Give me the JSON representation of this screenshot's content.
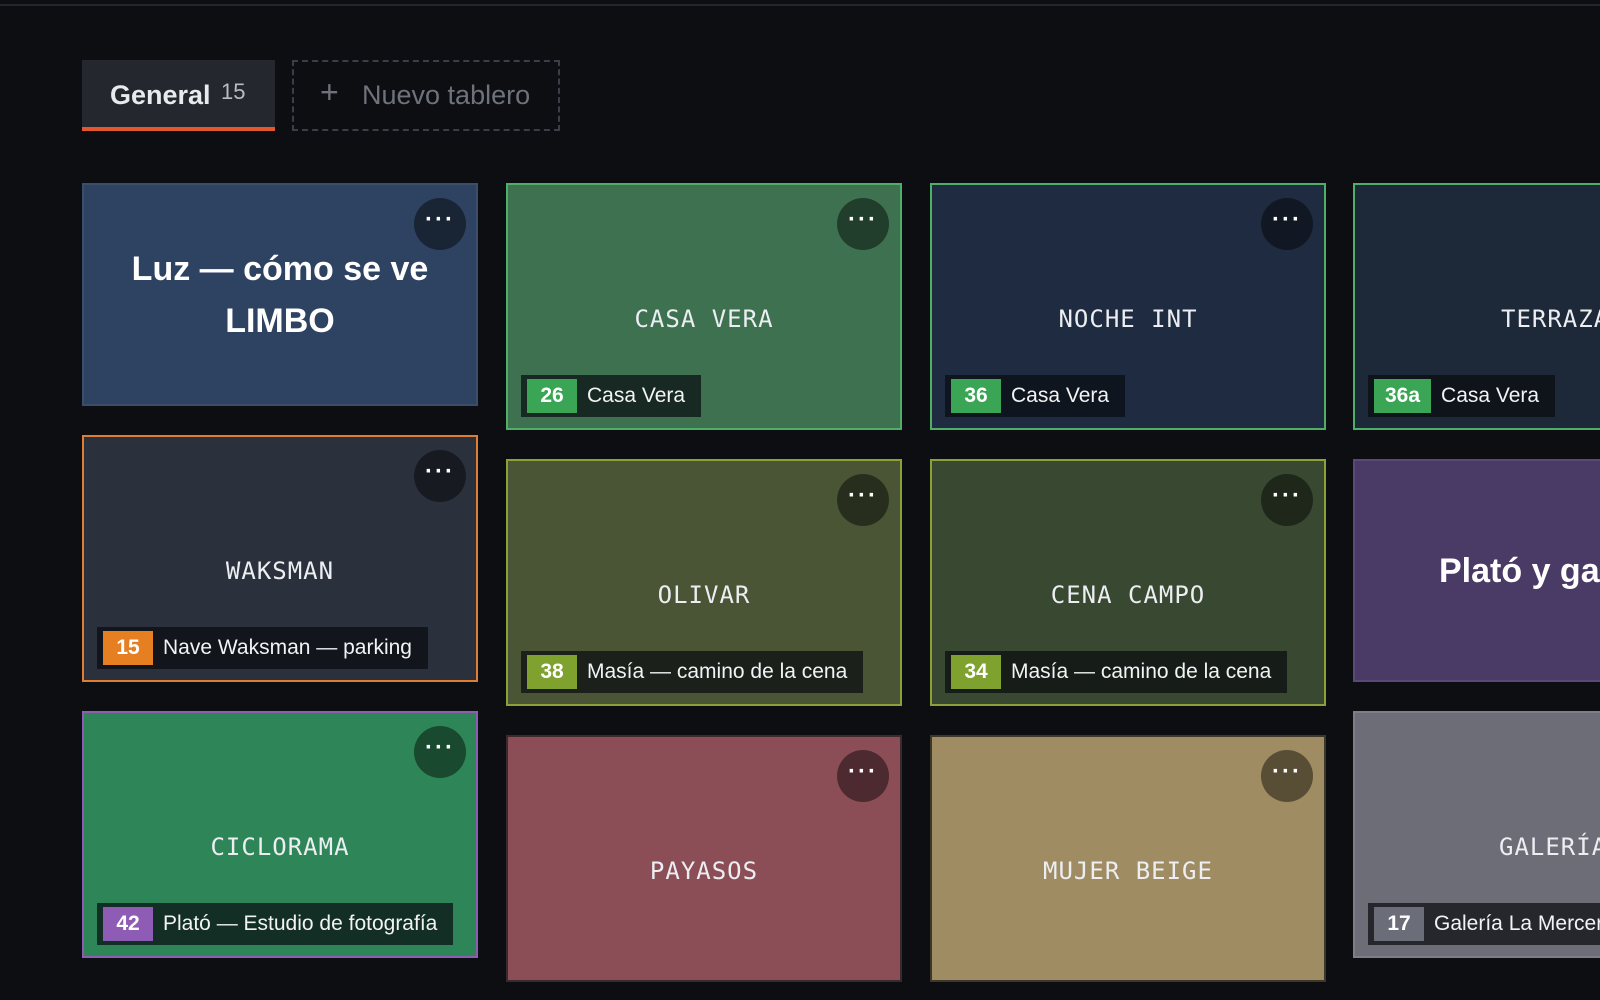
{
  "tabs": {
    "general_label": "General",
    "general_count": "15",
    "new_board_label": "Nuevo tablero"
  },
  "more_glyph": "···",
  "colors": {
    "accent": "#e4572e",
    "green_tag": "#3aa655",
    "olive_tag": "#7fa12e",
    "orange_tag": "#e67e22",
    "purple_tag": "#8e5bb5",
    "gray_tag": "#6b6e78"
  },
  "cards": [
    {
      "title": "Luz — cómo se ve LIMBO",
      "style": "bold"
    },
    {
      "title": "CASA VERA",
      "tag_num": "26",
      "tag_label": "Casa Vera"
    },
    {
      "title": "NOCHE INT",
      "tag_num": "36",
      "tag_label": "Casa Vera"
    },
    {
      "title": "TERRAZA",
      "tag_num": "36a",
      "tag_label": "Casa Vera"
    },
    {
      "title": "WAKSMAN",
      "tag_num": "15",
      "tag_label": "Nave Waksman — parking"
    },
    {
      "title": "OLIVAR",
      "tag_num": "38",
      "tag_label": "Masía — camino de la cena"
    },
    {
      "title": "CENA CAMPO",
      "tag_num": "34",
      "tag_label": "Masía — camino de la cena"
    },
    {
      "title": "Plató y gal",
      "style": "bold"
    },
    {
      "title": "CICLORAMA",
      "tag_num": "42",
      "tag_label": "Plató — Estudio de fotografía"
    },
    {
      "title": "PAYASOS"
    },
    {
      "title": "MUJER BEIGE"
    },
    {
      "title": "GALERÍA",
      "tag_num": "17",
      "tag_label": "Galería La Mercer"
    }
  ]
}
